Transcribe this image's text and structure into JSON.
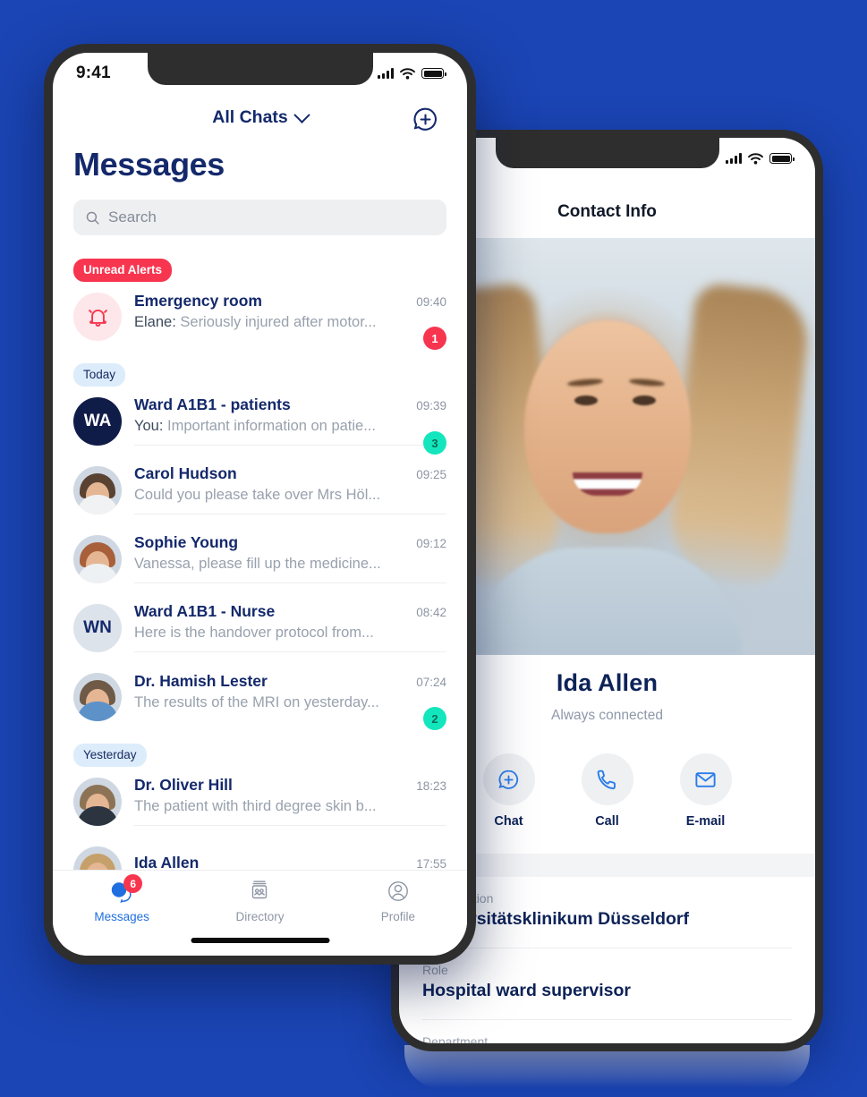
{
  "theme": {
    "background": "#1b45b4",
    "navy": "#14296b",
    "red": "#f8354f",
    "teal": "#13e6bd",
    "blue": "#1f6fe0"
  },
  "right_phone": {
    "status_bar": {
      "signal": "signal-icon",
      "wifi": "wifi-icon",
      "battery": "battery-icon"
    },
    "title": "Contact Info",
    "contact": {
      "name": "Ida Allen",
      "status": "Always connected",
      "photo_alt": "portrait-photo"
    },
    "actions": [
      {
        "label": "Chat",
        "icon": "chat-plus-icon"
      },
      {
        "label": "Call",
        "icon": "phone-icon"
      },
      {
        "label": "E-mail",
        "icon": "envelope-icon"
      }
    ],
    "fields": [
      {
        "label": "Organization",
        "value": "Universitätsklinikum Düsseldorf"
      },
      {
        "label": "Role",
        "value": "Hospital ward supervisor"
      },
      {
        "label": "Department",
        "value": ""
      }
    ]
  },
  "left_phone": {
    "status_bar": {
      "time": "9:41",
      "signal": "signal-icon",
      "wifi": "wifi-icon",
      "battery": "battery-icon"
    },
    "header": {
      "filter": "All Chats",
      "chevron": "chevron-down-icon",
      "compose": "compose-icon"
    },
    "page_title": "Messages",
    "search": {
      "placeholder": "Search",
      "icon": "search-icon"
    },
    "sections": [
      {
        "pill": "Unread Alerts",
        "pill_type": "alert"
      },
      {
        "pill": "Today",
        "pill_type": "day"
      },
      {
        "pill": "Yesterday",
        "pill_type": "day"
      }
    ],
    "chats": [
      {
        "avatar_type": "bell",
        "avatar_text": "",
        "name": "Emergency room",
        "preview_sender": "Elane:",
        "preview": " Seriously injured after motor...",
        "time": "09:40",
        "badge": "1",
        "badge_type": "red"
      },
      {
        "avatar_type": "navy",
        "avatar_text": "WA",
        "name": "Ward A1B1 - patients",
        "preview_sender": "You:",
        "preview": " Important information on patie...",
        "time": "09:39",
        "badge": "3",
        "badge_type": "teal"
      },
      {
        "avatar_type": "photo",
        "avatar_text": "",
        "name": "Carol Hudson",
        "preview_sender": "",
        "preview": "Could you please take over Mrs Höl...",
        "time": "09:25",
        "badge": "",
        "badge_type": ""
      },
      {
        "avatar_type": "photo",
        "avatar_text": "",
        "name": "Sophie Young",
        "preview_sender": "",
        "preview": "Vanessa, please fill up the medicine...",
        "time": "09:12",
        "badge": "",
        "badge_type": ""
      },
      {
        "avatar_type": "gray",
        "avatar_text": "WN",
        "name": "Ward A1B1 - Nurse",
        "preview_sender": "",
        "preview": "Here is the handover protocol from...",
        "time": "08:42",
        "badge": "",
        "badge_type": ""
      },
      {
        "avatar_type": "photo",
        "avatar_text": "",
        "name": "Dr. Hamish Lester",
        "preview_sender": "",
        "preview": "The results of the MRI on yesterday...",
        "time": "07:24",
        "badge": "2",
        "badge_type": "teal"
      },
      {
        "avatar_type": "photo",
        "avatar_text": "",
        "name": "Dr. Oliver Hill",
        "preview_sender": "",
        "preview": "The patient with third degree skin b...",
        "time": "18:23",
        "badge": "",
        "badge_type": ""
      },
      {
        "avatar_type": "photo",
        "avatar_text": "",
        "name": "Ida Allen",
        "preview_sender": "",
        "preview": "",
        "time": "17:55",
        "badge": "",
        "badge_type": ""
      }
    ],
    "tabs": [
      {
        "label": "Messages",
        "icon": "messages-icon",
        "badge": "6",
        "active": true
      },
      {
        "label": "Directory",
        "icon": "directory-icon",
        "badge": "",
        "active": false
      },
      {
        "label": "Profile",
        "icon": "profile-icon",
        "badge": "",
        "active": false
      }
    ]
  }
}
